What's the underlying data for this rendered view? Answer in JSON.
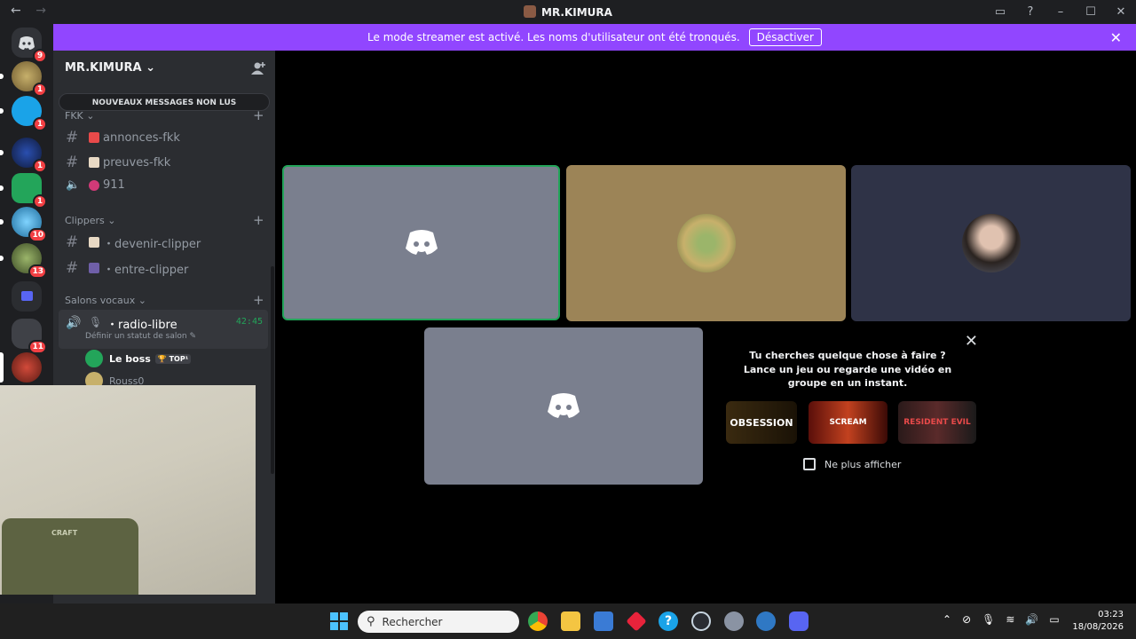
{
  "window": {
    "back": "←",
    "forward": "→",
    "title": "MR.KIMURA"
  },
  "banner": {
    "text": "Le mode streamer est activé. Les noms d'utilisateur ont été tronqués.",
    "button": "Désactiver",
    "close": "✕"
  },
  "guilds": [
    {
      "name": "home",
      "badge": "9"
    },
    {
      "name": "server-1",
      "badge": "1"
    },
    {
      "name": "server-2",
      "badge": "1"
    },
    {
      "name": "server-3",
      "badge": "1"
    },
    {
      "name": "server-4",
      "badge": "1"
    },
    {
      "name": "server-5",
      "badge": "10"
    },
    {
      "name": "server-6",
      "badge": "13"
    },
    {
      "name": "folder",
      "badge": ""
    },
    {
      "name": "server-7",
      "badge": "11"
    },
    {
      "name": "server-8",
      "badge": ""
    }
  ],
  "sidebar": {
    "server_name": "MR.KIMURA",
    "new_messages": "NOUVEAUX MESSAGES NON LUS",
    "categories": {
      "fkk": "FKK",
      "clippers": "Clippers",
      "voice": "Salons vocaux"
    },
    "channels": {
      "annonces": "annonces-fkk",
      "preuves": "preuves-fkk",
      "nine11": "911",
      "devenir": "・devenir-clipper",
      "entre": "・entre-clipper"
    },
    "voice_channel": {
      "name": "・radio-libre",
      "time": "42:45",
      "status": "Définir un statut de salon"
    },
    "voice_users": [
      {
        "name": "Le boss",
        "tag": "TOP¹"
      },
      {
        "name": "Rouss0",
        "tag": ""
      }
    ]
  },
  "webcam": {
    "chair_logo": "CRAFT"
  },
  "activity": {
    "title": "Tu cherches quelque chose à faire ?",
    "subtitle": "Lance un jeu ou regarde une vidéo en groupe en un instant.",
    "games": [
      "OBSESSION",
      "SCREAM",
      "RESIDENT EVIL"
    ],
    "dont_show": "Ne plus afficher"
  },
  "taskbar": {
    "search_placeholder": "Rechercher",
    "time": "03:23",
    "date": "18/08/2026"
  },
  "colors": {
    "banner": "#9146ff",
    "voice_green": "#23a55a",
    "tile_gray": "#7a7f8e",
    "tile_tan": "#9c8457",
    "tile_navy": "#2f3347"
  }
}
